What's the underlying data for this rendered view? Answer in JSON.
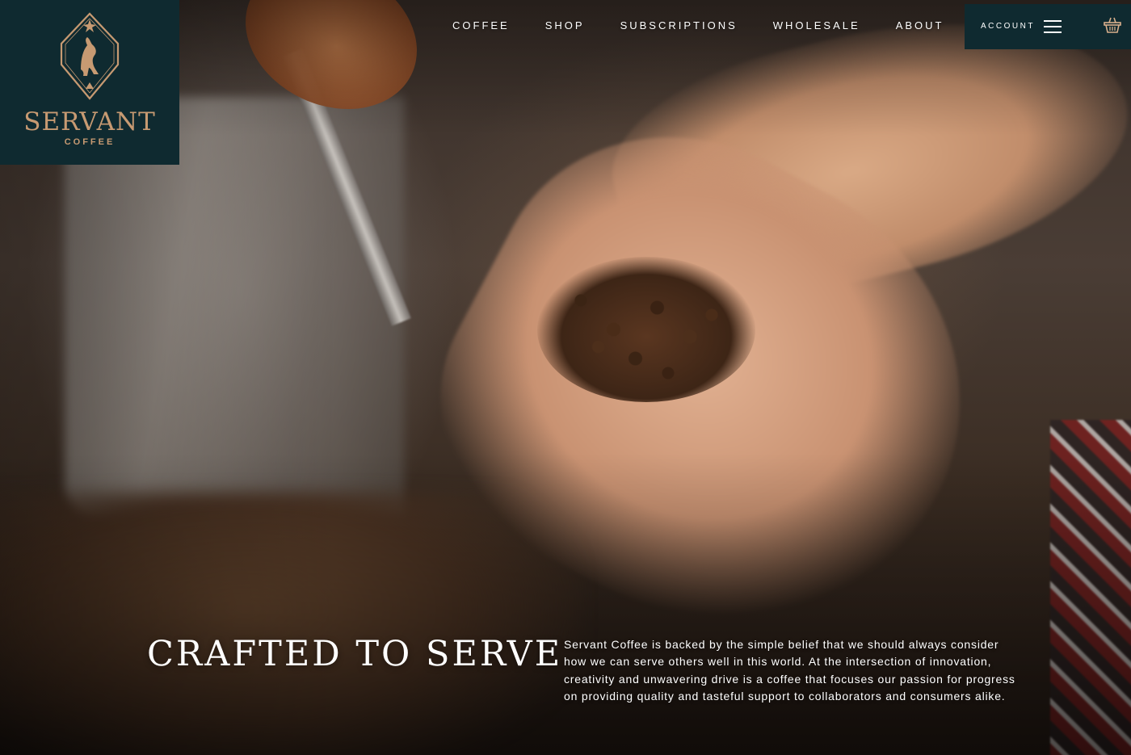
{
  "logo": {
    "name": "SERVANT",
    "sub": "COFFEE"
  },
  "nav": {
    "items": [
      "COFFEE",
      "SHOP",
      "SUBSCRIPTIONS",
      "WHOLESALE",
      "ABOUT"
    ]
  },
  "account": {
    "label": "ACCOUNT",
    "menu_icon": "hamburger-menu-icon",
    "cart_icon": "shopping-basket-icon"
  },
  "hero": {
    "headline": "CRAFTED TO SERVE",
    "body": "Servant Coffee is backed by the simple belief that we should always consider how we can serve others well in this world. At the intersection of innovation, creativity and unwavering drive is a coffee that focuses our passion for progress on providing quality and tasteful support to collaborators and consumers alike."
  },
  "colors": {
    "brand_dark": "#0f2a30",
    "brand_copper": "#c79a72",
    "text_light": "#ffffff"
  }
}
